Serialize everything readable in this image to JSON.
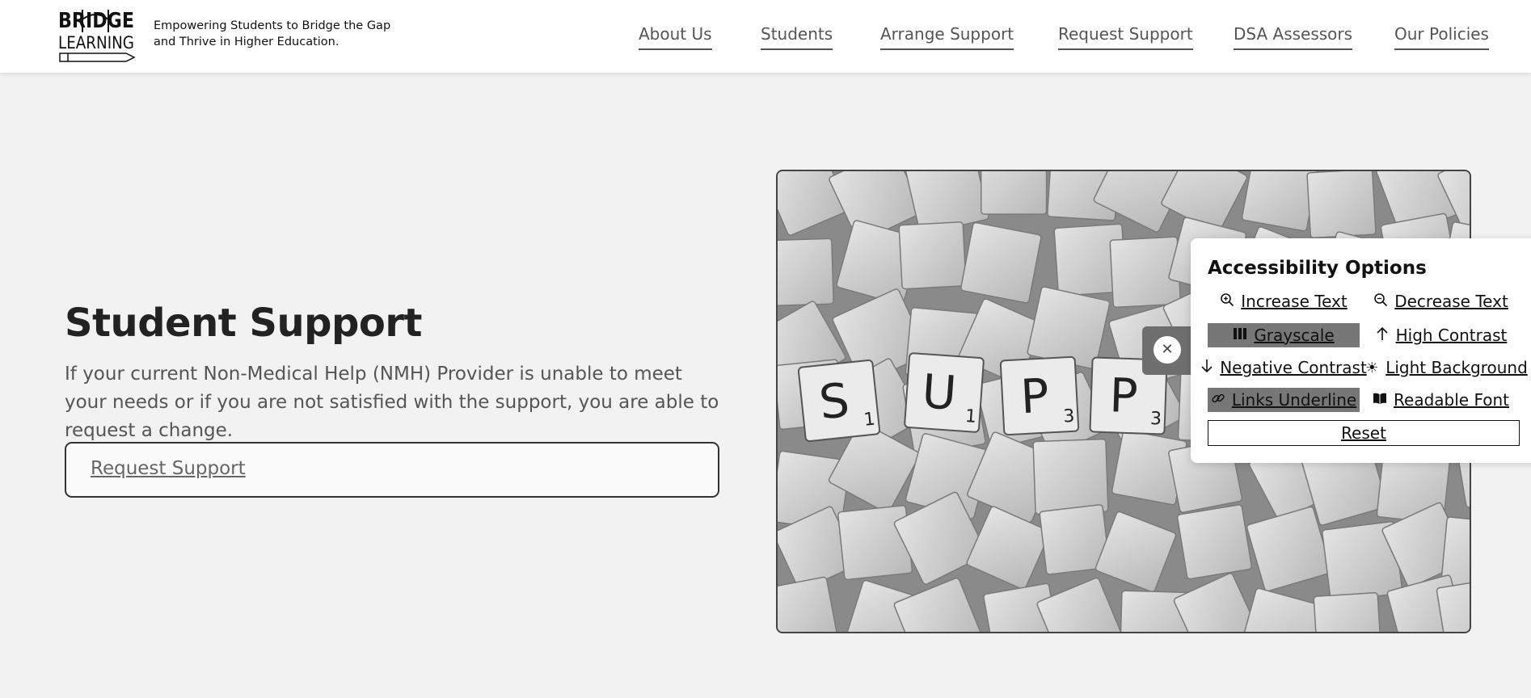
{
  "header": {
    "logo_line1": "BRIDGE",
    "logo_line2": "LEARNING",
    "tagline": "Empowering Students to Bridge the Gap and Thrive in Higher Education.",
    "nav": [
      "About Us",
      "Students",
      "Arrange Support",
      "Request Support",
      "DSA Assessors",
      "Our Policies"
    ]
  },
  "hero": {
    "title": "Student Support",
    "body": "If your current Non-Medical Help (NMH) Provider is unable to meet your needs or if you are not satisfied with the support, you are able to request a change.",
    "button_label": "Request Support"
  },
  "image": {
    "tiles": [
      {
        "letter": "S",
        "score": "1"
      },
      {
        "letter": "U",
        "score": "1"
      },
      {
        "letter": "P",
        "score": "3"
      },
      {
        "letter": "P",
        "score": "3"
      }
    ]
  },
  "accessibility": {
    "title": "Accessibility Options",
    "close_icon": "close-icon",
    "options": [
      {
        "label": "Increase Text",
        "icon": "zoom-in-icon",
        "active": false
      },
      {
        "label": "Decrease Text",
        "icon": "zoom-out-icon",
        "active": false
      },
      {
        "label": "Grayscale",
        "icon": "grayscale-icon",
        "active": true
      },
      {
        "label": "High Contrast",
        "icon": "arrow-up-icon",
        "active": false
      },
      {
        "label": "Negative Contrast",
        "icon": "arrow-down-icon",
        "active": false
      },
      {
        "label": "Light Background",
        "icon": "sun-icon",
        "active": false
      },
      {
        "label": "Links Underline",
        "icon": "link-icon",
        "active": true
      },
      {
        "label": "Readable Font",
        "icon": "book-icon",
        "active": false
      }
    ],
    "reset_label": "Reset"
  }
}
